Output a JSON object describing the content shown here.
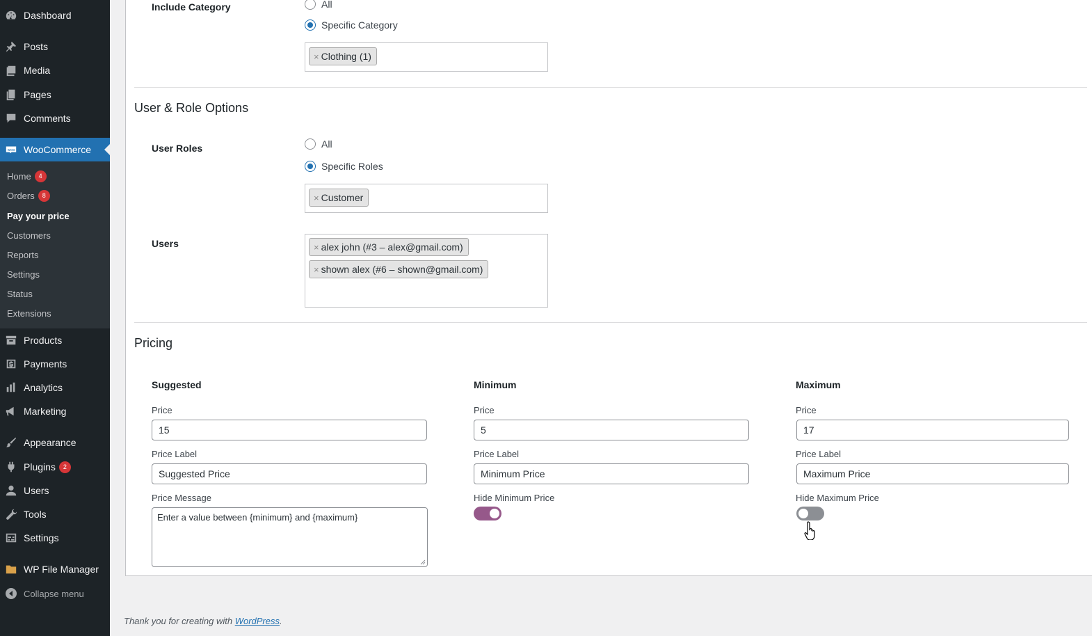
{
  "sidebar": {
    "items": [
      {
        "label": "Dashboard",
        "icon": "dashboard-icon"
      },
      {
        "label": "Posts",
        "icon": "pin-icon"
      },
      {
        "label": "Media",
        "icon": "media-icon"
      },
      {
        "label": "Pages",
        "icon": "pages-icon"
      },
      {
        "label": "Comments",
        "icon": "comment-icon"
      },
      {
        "label": "WooCommerce",
        "icon": "woo-icon"
      },
      {
        "label": "Products",
        "icon": "archive-icon"
      },
      {
        "label": "Payments",
        "icon": "dollar-icon"
      },
      {
        "label": "Analytics",
        "icon": "chart-bar-icon"
      },
      {
        "label": "Marketing",
        "icon": "megaphone-icon"
      },
      {
        "label": "Appearance",
        "icon": "paintbrush-icon"
      },
      {
        "label": "Plugins",
        "icon": "plugin-icon",
        "badge": "2"
      },
      {
        "label": "Users",
        "icon": "user-icon"
      },
      {
        "label": "Tools",
        "icon": "wrench-icon"
      },
      {
        "label": "Settings",
        "icon": "sliders-icon"
      },
      {
        "label": "WP File Manager",
        "icon": "folder-icon"
      }
    ],
    "submenu": [
      {
        "label": "Home",
        "badge": "4"
      },
      {
        "label": "Orders",
        "badge": "8"
      },
      {
        "label": "Pay your price"
      },
      {
        "label": "Customers"
      },
      {
        "label": "Reports"
      },
      {
        "label": "Settings"
      },
      {
        "label": "Status"
      },
      {
        "label": "Extensions"
      }
    ],
    "collapse_label": "Collapse menu"
  },
  "include_category": {
    "label": "Include Category",
    "options": [
      "All",
      "Specific Category"
    ],
    "selected": "Specific Category",
    "chips": [
      "Clothing (1)"
    ]
  },
  "user_role_section": {
    "title": "User & Role Options",
    "roles_label": "User Roles",
    "role_options": [
      "All",
      "Specific Roles"
    ],
    "role_selected": "Specific Roles",
    "role_chips": [
      "Customer"
    ],
    "users_label": "Users",
    "user_chips": [
      "alex john (#3 – alex@gmail.com)",
      "shown alex (#6 – shown@gmail.com)"
    ]
  },
  "pricing": {
    "title": "Pricing",
    "suggested": {
      "title": "Suggested",
      "price_label": "Price",
      "price": "15",
      "price_label_label": "Price Label",
      "price_label_value": "Suggested Price",
      "message_label": "Price Message",
      "message": "Enter a value between {minimum} and {maximum}"
    },
    "minimum": {
      "title": "Minimum",
      "price_label": "Price",
      "price": "5",
      "price_label_label": "Price Label",
      "price_label_value": "Minimum Price",
      "hide_label": "Hide Minimum Price",
      "hide_on": true
    },
    "maximum": {
      "title": "Maximum",
      "price_label": "Price",
      "price": "17",
      "price_label_label": "Price Label",
      "price_label_value": "Maximum Price",
      "hide_label": "Hide Maximum Price",
      "hide_on": false
    }
  },
  "footer": {
    "text": "Thank you for creating with ",
    "link": "WordPress",
    "suffix": "."
  },
  "colors": {
    "sidebar_bg": "#1d2327",
    "active_blue": "#2271b1",
    "toggle_on": "#96588a",
    "badge_red": "#d63638"
  }
}
